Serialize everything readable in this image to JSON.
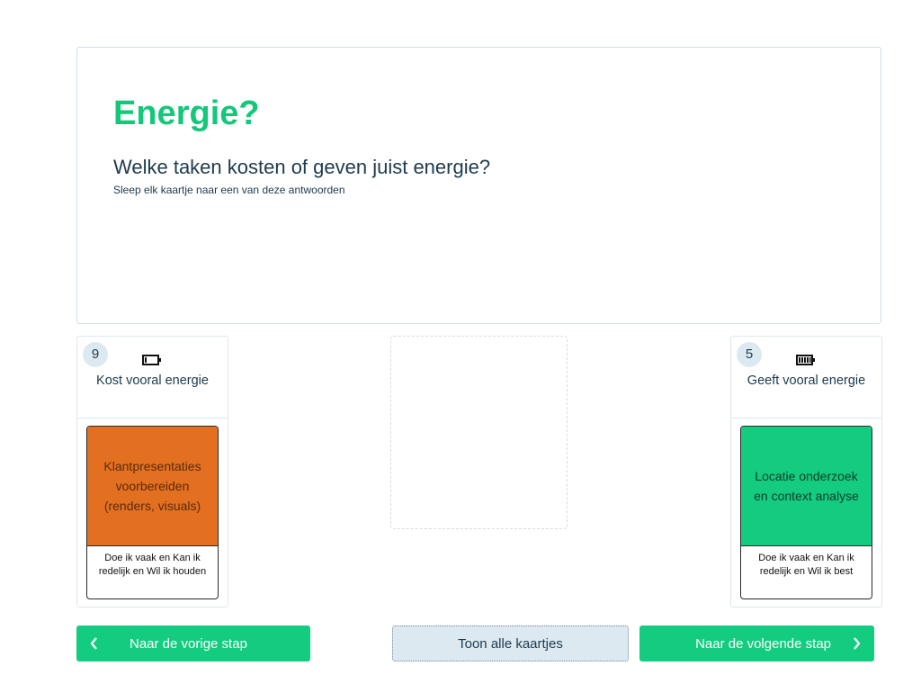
{
  "intro": {
    "title": "Energie?",
    "question": "Welke taken kosten of geven juist energie?",
    "instruction": "Sleep elk kaartje naar een van deze antwoorden"
  },
  "columns": [
    {
      "count": "9",
      "icon": "battery-low-icon",
      "label": "Kost vooral energie",
      "card": {
        "color": "#e37021",
        "title": "Klantpresentaties voorbereiden (renders, visuals)",
        "note": "Doe ik vaak en Kan ik redelijk en Wil ik houden"
      }
    },
    {
      "count": "5",
      "icon": "battery-full-icon",
      "label": "Geeft vooral energie",
      "card": {
        "color": "#14cc80",
        "title": "Locatie onderzoek en context analyse",
        "note": "Doe ik vaak en Kan ik redelijk en Wil ik best"
      }
    }
  ],
  "buttons": {
    "prev": "Naar de vorige stap",
    "show_all": "Toon alle kaartjes",
    "next": "Naar de volgende stap"
  },
  "colors": {
    "accent": "#14cc80",
    "title": "#14c87a",
    "secondary_button": "#dde9f1"
  }
}
